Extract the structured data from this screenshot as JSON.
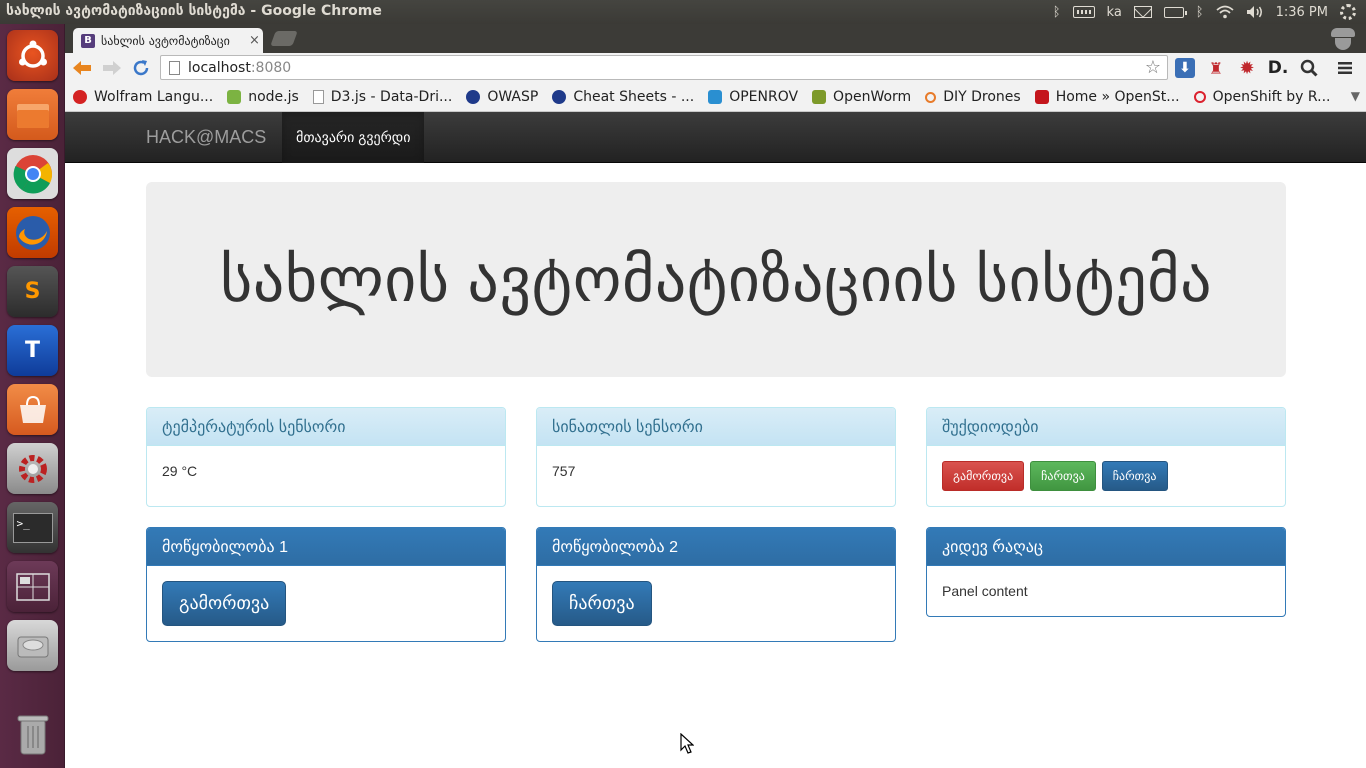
{
  "os_panel": {
    "window_title": "სახლის ავტომატიზაციის სისტემა - Google Chrome",
    "keyboard_layout": "ka",
    "clock": "1:36 PM"
  },
  "launcher": {
    "items": [
      "ubuntu-dash",
      "files",
      "chrome",
      "firefox",
      "sublime-text",
      "text-editor",
      "software-center",
      "system-settings",
      "terminal",
      "workspaces",
      "disk",
      "trash"
    ]
  },
  "browser": {
    "tab_title": "სახლის ავტომატიზაცი",
    "tab_close": "×",
    "url_host": "localhost",
    "url_port": ":8080",
    "bookmarks": [
      {
        "label": "Wolfram Langu...",
        "icon_color": "#d42222"
      },
      {
        "label": "node.js",
        "icon_color": "#7cb342"
      },
      {
        "label": "D3.js - Data-Dri...",
        "icon_color": "#ffffff"
      },
      {
        "label": "OWASP",
        "icon_color": "#1f3a8a"
      },
      {
        "label": "Cheat Sheets - ...",
        "icon_color": "#1f3a8a"
      },
      {
        "label": "OPENROV",
        "icon_color": "#2a8fd1"
      },
      {
        "label": "OpenWorm",
        "icon_color": "#7d9a2a"
      },
      {
        "label": "DIY Drones",
        "icon_color": "#e87b2a"
      },
      {
        "label": "Home » OpenSt...",
        "icon_color": "#c4161c"
      },
      {
        "label": "OpenShift by R...",
        "icon_color": "#db212e"
      }
    ]
  },
  "navbar": {
    "brand": "HACK@MACS",
    "active_item": "მთავარი გვერდი"
  },
  "jumbotron": {
    "title": "სახლის ავტომატიზაციის სისტემა"
  },
  "panels": {
    "temperature": {
      "heading": "ტემპერატურის სენსორი",
      "value": "29 °C"
    },
    "light": {
      "heading": "სინათლის სენსორი",
      "value": "757"
    },
    "leds": {
      "heading": "შუქდიოდები",
      "buttons": [
        "გამორთვა",
        "ჩართვა",
        "ჩართვა"
      ]
    },
    "device1": {
      "heading": "მოწყობილობა 1",
      "button": "გამორთვა"
    },
    "device2": {
      "heading": "მოწყობილობა 2",
      "button": "ჩართვა"
    },
    "other": {
      "heading": "კიდევ რაღაც",
      "content": "Panel content"
    }
  }
}
